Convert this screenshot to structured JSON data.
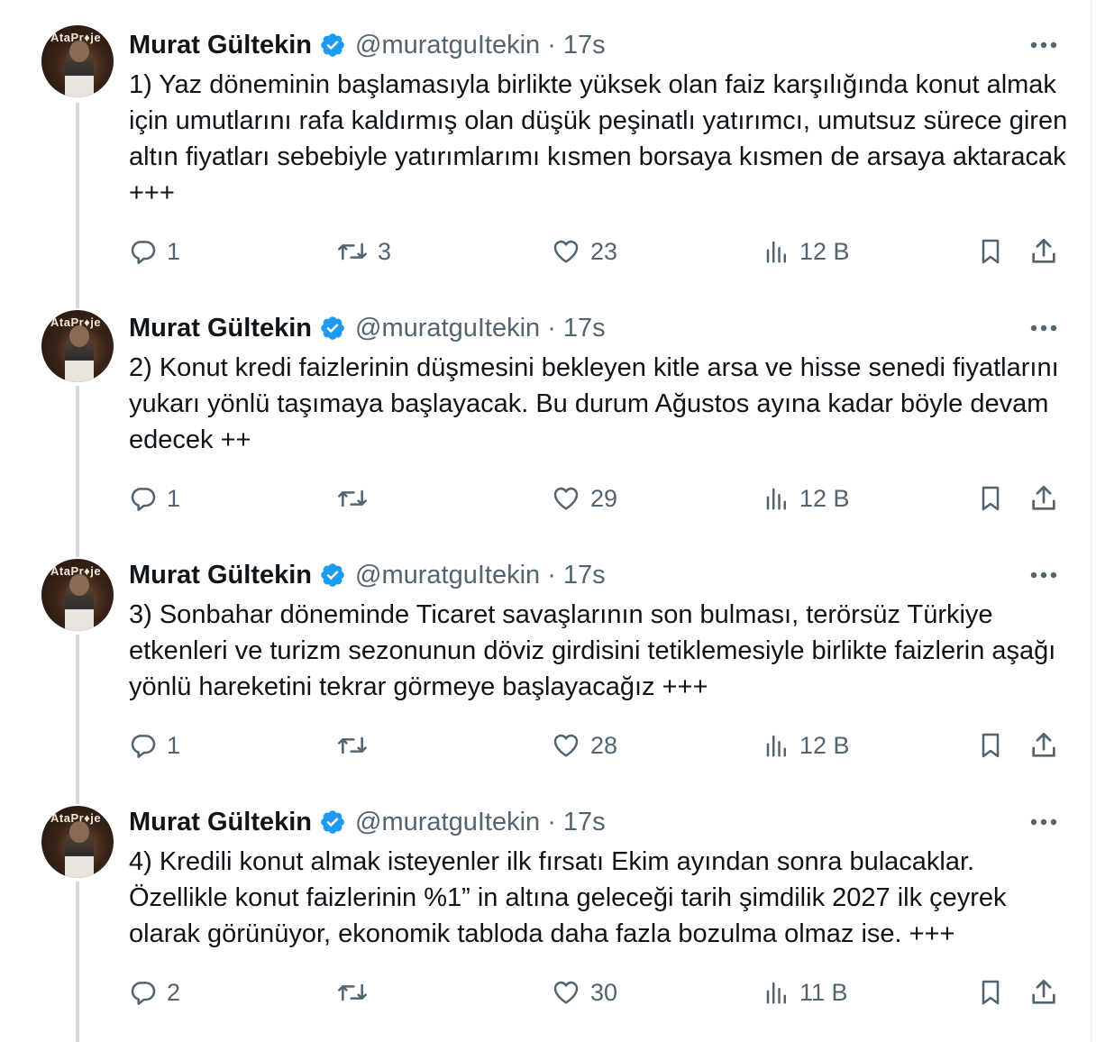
{
  "brand": {
    "verified_color": "#1d9bf0",
    "text_color": "#0f1419",
    "muted_color": "#536471"
  },
  "avatar_sign": "AtaPr♦je",
  "tweets": [
    {
      "name": "Murat Gültekin",
      "handle": "@muratguItekin · 17s",
      "text": "1) Yaz döneminin başlamasıyla birlikte yüksek olan faiz karşılığında konut almak için umutlarını rafa kaldırmış olan düşük peşinatlı yatırımcı, umutsuz sürece giren altın fiyatları sebebiyle yatırımlarımı kısmen borsaya kısmen de arsaya aktaracak +++",
      "replies": "1",
      "reposts": "3",
      "likes": "23",
      "views": "12 B"
    },
    {
      "name": "Murat Gültekin",
      "handle": "@muratguItekin · 17s",
      "text": "2) Konut kredi faizlerinin düşmesini bekleyen kitle arsa ve hisse senedi fiyatlarını yukarı yönlü taşımaya başlayacak. Bu durum Ağustos ayına kadar böyle devam edecek ++",
      "replies": "1",
      "reposts": "",
      "likes": "29",
      "views": "12 B"
    },
    {
      "name": "Murat Gültekin",
      "handle": "@muratguItekin · 17s",
      "text": "3) Sonbahar döneminde Ticaret savaşlarının son bulması, terörsüz Türkiye etkenleri ve turizm sezonunun döviz girdisini tetiklemesiyle birlikte faizlerin aşağı yönlü hareketini tekrar görmeye başlayacağız +++",
      "replies": "1",
      "reposts": "",
      "likes": "28",
      "views": "12 B"
    },
    {
      "name": "Murat Gültekin",
      "handle": "@muratguItekin · 17s",
      "text": "4) Kredili konut almak isteyenler ilk fırsatı Ekim ayından sonra bulacaklar. Özellikle konut faizlerinin %1” in altına geleceği tarih şimdilik 2027 ilk çeyrek olarak görünüyor, ekonomik tabloda daha fazla bozulma olmaz ise. +++",
      "replies": "2",
      "reposts": "",
      "likes": "30",
      "views": "11 B"
    }
  ]
}
